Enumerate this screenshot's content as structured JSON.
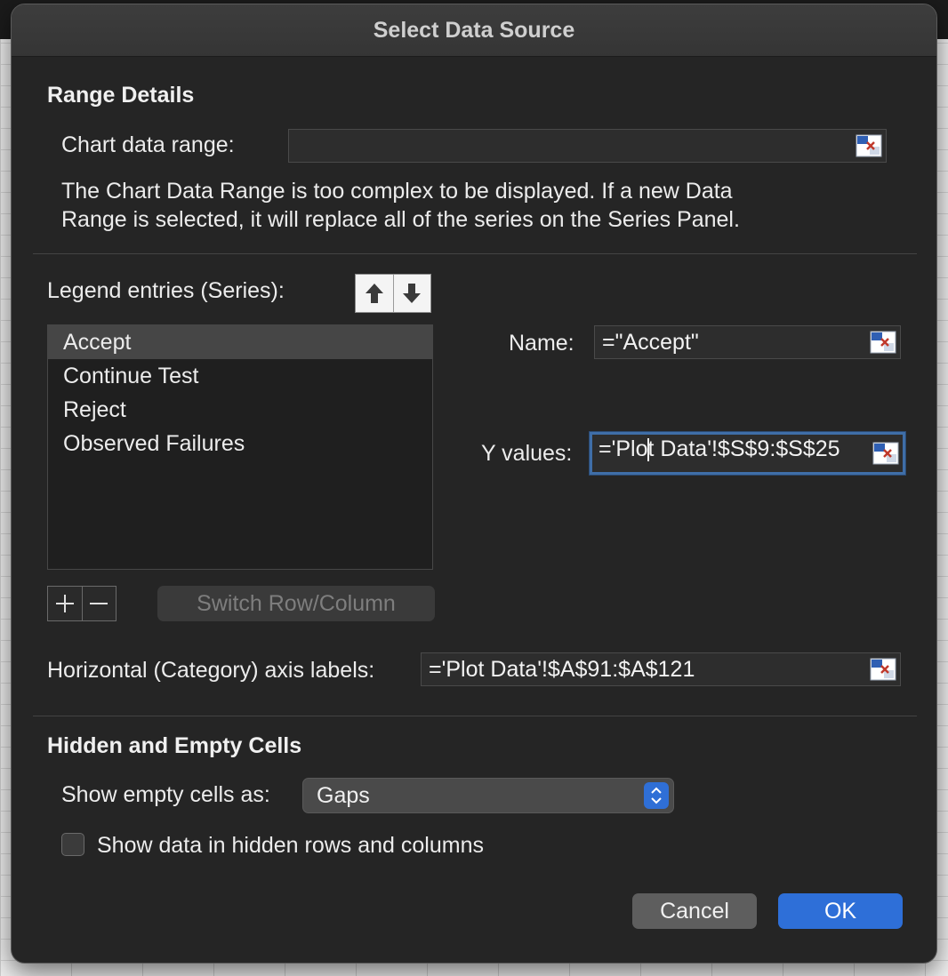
{
  "window": {
    "title": "Select Data Source"
  },
  "range_details": {
    "heading": "Range Details",
    "chart_data_range_label": "Chart data range:",
    "chart_data_range_value": "",
    "message_line1": "The Chart Data Range is too complex to be displayed. If a new Data",
    "message_line2": "Range is selected, it will replace all of the series on the Series Panel."
  },
  "series": {
    "legend_label": "Legend entries (Series):",
    "move_up_icon": "arrow-up-icon",
    "move_down_icon": "arrow-down-icon",
    "items": [
      {
        "label": "Accept",
        "selected": true
      },
      {
        "label": "Continue Test",
        "selected": false
      },
      {
        "label": "Reject",
        "selected": false
      },
      {
        "label": "Observed Failures",
        "selected": false
      }
    ],
    "add_icon": "plus-icon",
    "remove_icon": "minus-icon",
    "switch_label": "Switch Row/Column",
    "name_label": "Name:",
    "name_value": "=\"Accept\"",
    "y_values_label": "Y values:",
    "y_values_before_caret": "='Plo",
    "y_values_after_caret": "t Data'!$S$9:$S$25",
    "axis_labels_label": "Horizontal (Category) axis labels:",
    "axis_labels_value": "='Plot Data'!$A$91:$A$121"
  },
  "hidden_empty": {
    "heading": "Hidden and Empty Cells",
    "show_empty_label": "Show empty cells as:",
    "show_empty_value": "Gaps",
    "show_hidden_label": "Show data in hidden rows and columns",
    "show_hidden_checked": false
  },
  "buttons": {
    "cancel": "Cancel",
    "ok": "OK"
  },
  "colors": {
    "accent": "#2e6fd8",
    "dialog_bg": "#252525",
    "focus_ring": "#3f6ea8"
  }
}
